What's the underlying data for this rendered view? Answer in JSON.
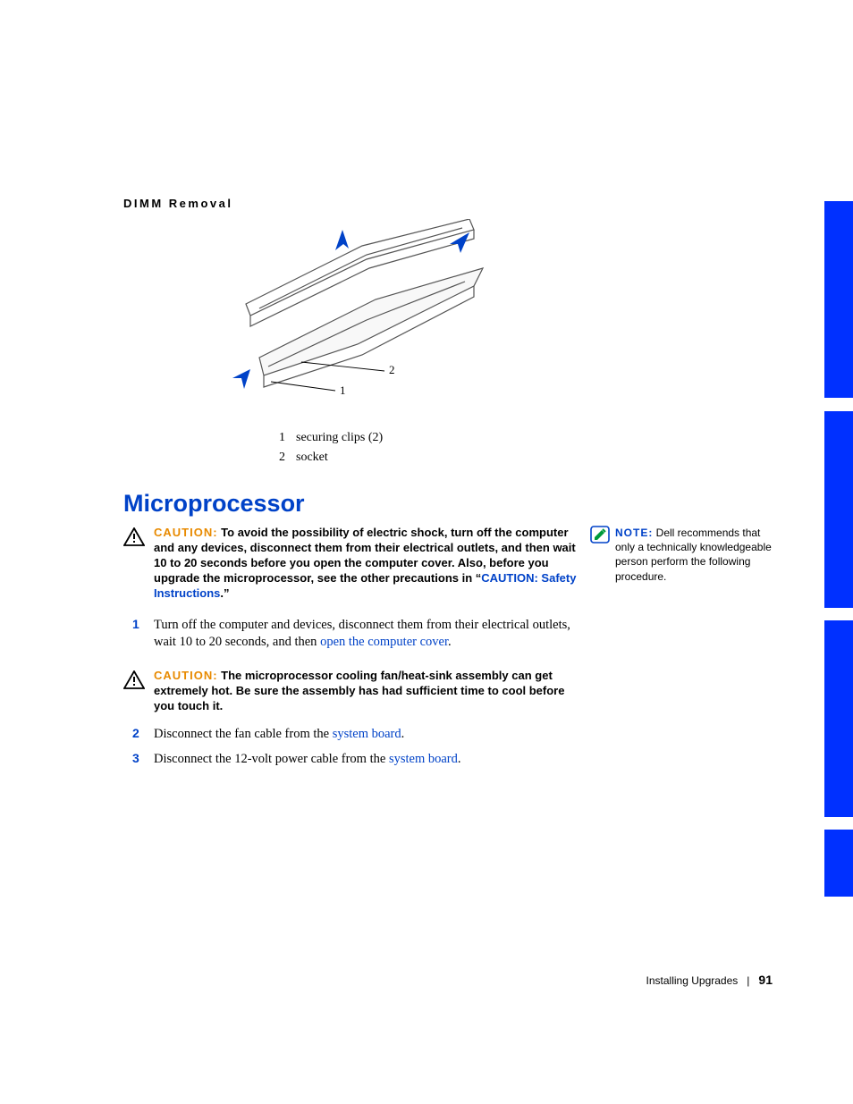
{
  "dimm_title": "DIMM Removal",
  "diagram_labels": {
    "l1": "1",
    "l2": "2"
  },
  "legend": [
    {
      "num": "1",
      "desc": "securing clips (2)"
    },
    {
      "num": "2",
      "desc": "socket"
    }
  ],
  "section_heading": "Microprocessor",
  "caution1": {
    "label": "CAUTION:",
    "pre": " To avoid the possibility of electric shock, turn off the computer and any devices, disconnect them from their electrical outlets, and then wait 10 to 20 seconds before you open the computer cover. Also, before you upgrade the microprocessor, see the other precautions in “",
    "link": "CAUTION: Safety Instructions",
    "post": ".”"
  },
  "caution2": {
    "label": "CAUTION:",
    "text": " The microprocessor cooling fan/heat-sink assembly can get extremely hot. Be sure the assembly has had sufficient time to cool before you touch it."
  },
  "steps": {
    "s1": {
      "num": "1",
      "pre": "Turn off the computer and devices, disconnect them from their electrical outlets, wait 10 to 20 seconds, and then ",
      "link": "open the computer cover",
      "post": "."
    },
    "s2": {
      "num": "2",
      "pre": "Disconnect the fan cable from the ",
      "link": "system board",
      "post": "."
    },
    "s3": {
      "num": "3",
      "pre": "Disconnect the 12-volt power cable from the ",
      "link": "system board",
      "post": "."
    }
  },
  "note": {
    "label": "NOTE:",
    "text": " Dell recommends that only a technically knowledgeable person perform the following procedure."
  },
  "footer": {
    "section": "Installing Upgrades",
    "sep": "|",
    "page": "91"
  }
}
